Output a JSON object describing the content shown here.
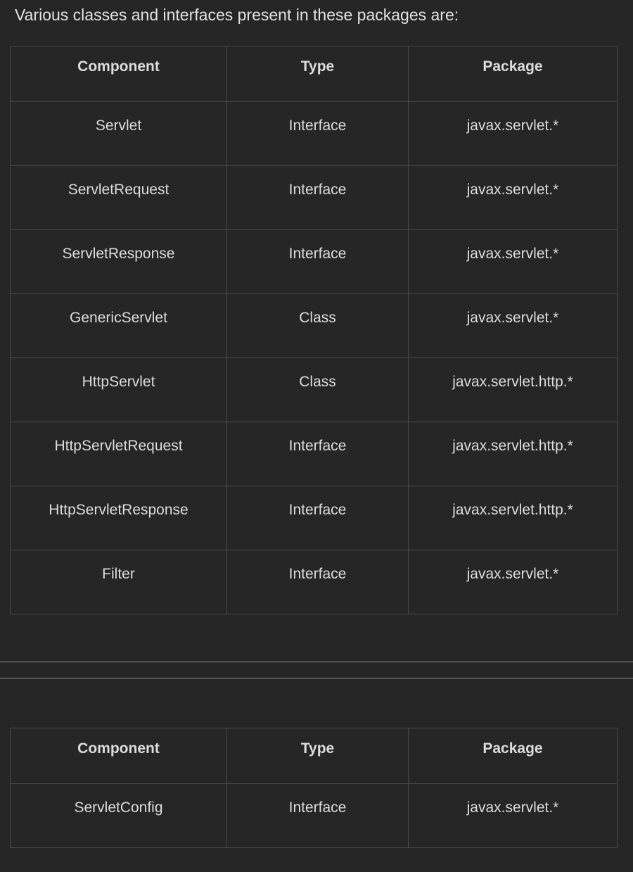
{
  "intro": "Various classes and interfaces present in these packages are:",
  "table1": {
    "headers": [
      "Component",
      "Type",
      "Package"
    ],
    "rows": [
      [
        "Servlet",
        "Interface",
        "javax.servlet.*"
      ],
      [
        "ServletRequest",
        "Interface",
        "javax.servlet.*"
      ],
      [
        "ServletResponse",
        "Interface",
        "javax.servlet.*"
      ],
      [
        "GenericServlet",
        "Class",
        "javax.servlet.*"
      ],
      [
        "HttpServlet",
        "Class",
        "javax.servlet.http.*"
      ],
      [
        "HttpServletRequest",
        "Interface",
        "javax.servlet.http.*"
      ],
      [
        "HttpServletResponse",
        "Interface",
        "javax.servlet.http.*"
      ],
      [
        "Filter",
        "Interface",
        "javax.servlet.*"
      ]
    ]
  },
  "table2": {
    "headers": [
      "Component",
      "Type",
      "Package"
    ],
    "rows": [
      [
        "ServletConfig",
        "Interface",
        "javax.servlet.*"
      ]
    ]
  },
  "colors": {
    "background": "#262626",
    "text": "#dcdcdc",
    "border": "#4a4a4a",
    "rule": "#8a8a8a"
  }
}
